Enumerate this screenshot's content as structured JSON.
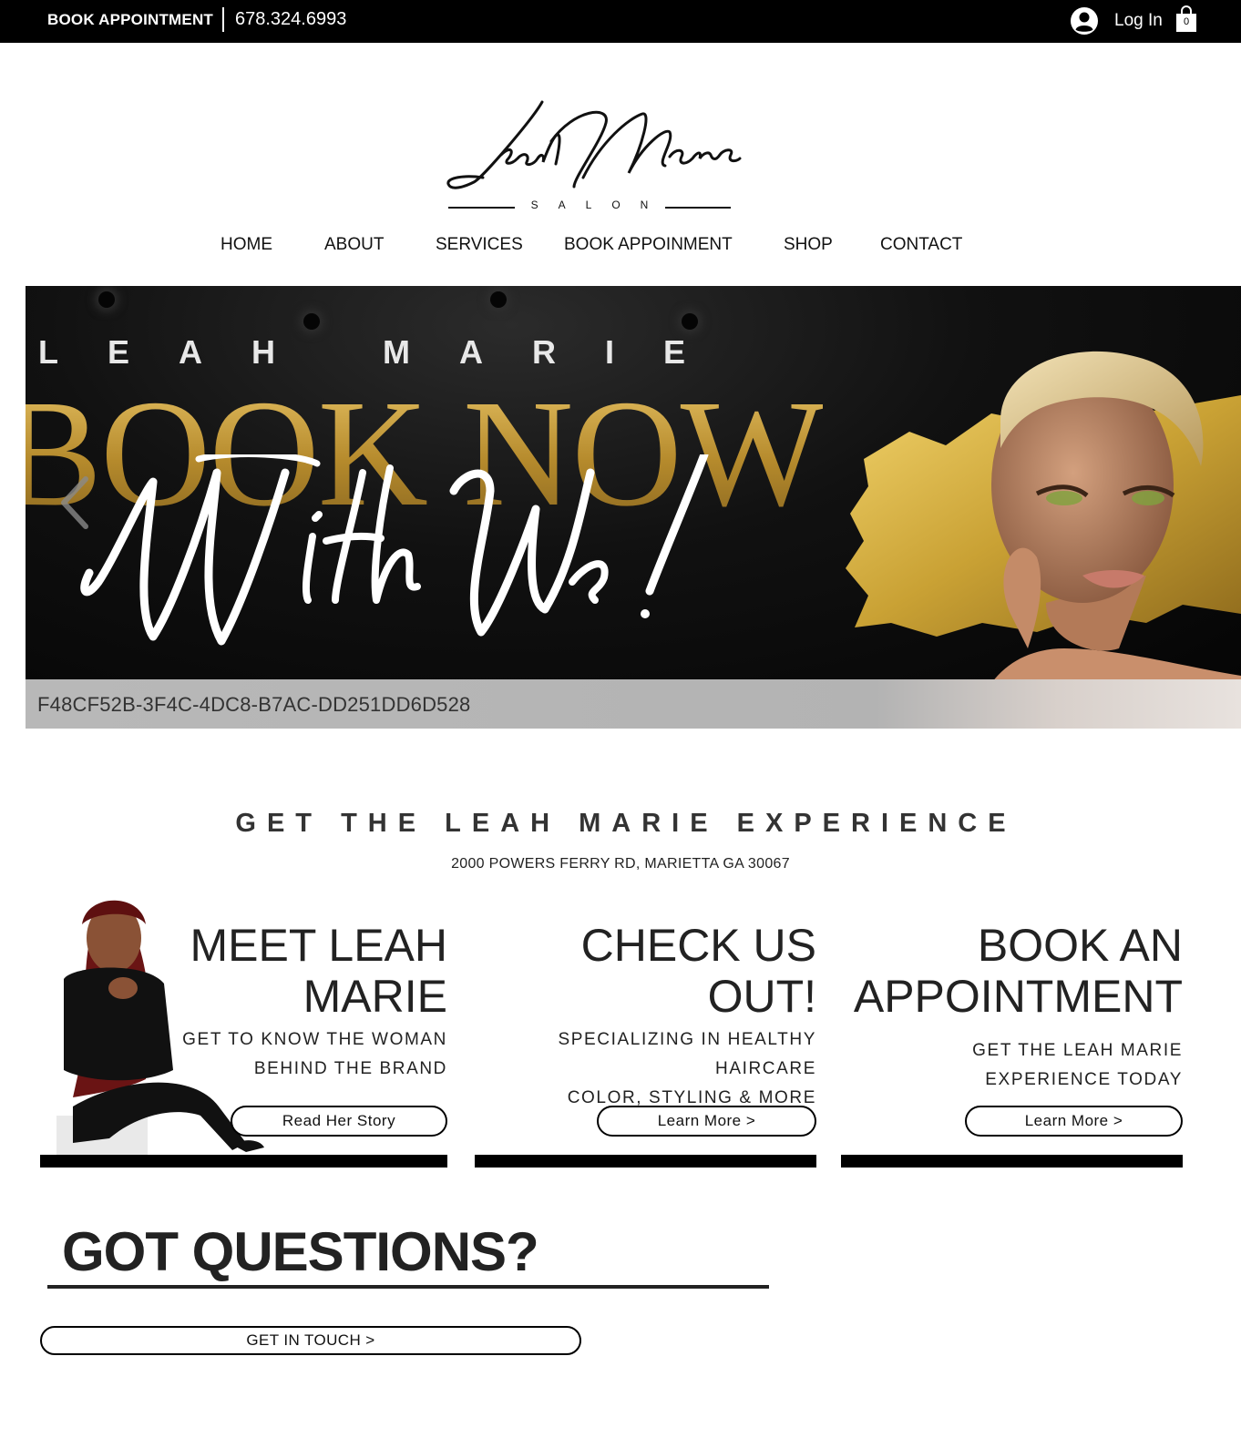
{
  "topbar": {
    "book_label": "BOOK APPOINTMENT",
    "phone": "678.324.6993",
    "login_label": "Log In",
    "cart_count": "0",
    "icons": [
      "user-avatar-icon",
      "shopping-bag-icon"
    ]
  },
  "logo": {
    "script": "Leah Marie",
    "subtitle": "SALON"
  },
  "nav": {
    "items": [
      "HOME",
      "ABOUT",
      "SERVICES",
      "BOOK APPOINMENT",
      "SHOP",
      "CONTACT"
    ]
  },
  "hero": {
    "tagline": "LEAH MARIE",
    "headline": "BOOK NOW",
    "script_text": "With Us!",
    "caption": "F48CF52B-3F4C-4DC8-B7AC-DD251DD6D528",
    "gold_color": "#c99e3a"
  },
  "experience": {
    "title": "GET THE LEAH MARIE EXPERIENCE",
    "address": "2000 POWERS FERRY RD, MARIETTA GA 30067"
  },
  "cards": [
    {
      "title_line1": "MEET LEAH",
      "title_line2": "MARIE",
      "desc_line1": "GET TO KNOW THE WOMAN",
      "desc_line2": "BEHIND THE BRAND",
      "button": "Read Her Story"
    },
    {
      "title_line1": "CHECK US",
      "title_line2": "OUT!",
      "desc_line1": "SPECIALIZING IN HEALTHY HAIRCARE",
      "desc_line2": "COLOR, STYLING & MORE",
      "button": "Learn More >"
    },
    {
      "title_line1": "BOOK AN",
      "title_line2": "APPOINTMENT",
      "desc_line1": "GET THE LEAH MARIE",
      "desc_line2": "EXPERIENCE TODAY",
      "button": "Learn More >"
    }
  ],
  "questions": {
    "title": "GOT QUESTIONS?",
    "button": "GET IN TOUCH >"
  }
}
